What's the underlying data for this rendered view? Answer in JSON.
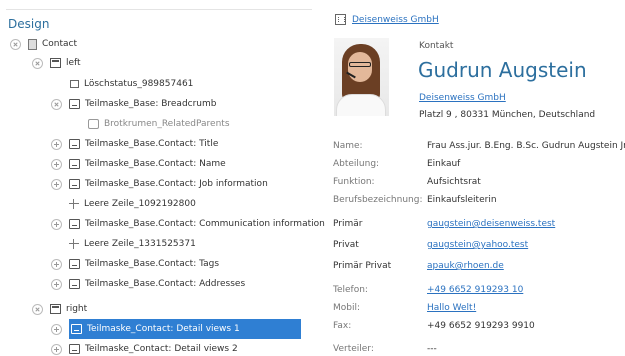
{
  "tree": {
    "title": "Design",
    "rows": [
      {
        "label": "Contact"
      },
      {
        "label": "left"
      },
      {
        "label": "Löschstatus_989857461"
      },
      {
        "label": "Teilmaske_Base: Breadcrumb"
      },
      {
        "label": "Brotkrumen_RelatedParents"
      },
      {
        "label": "Teilmaske_Base.Contact: Title"
      },
      {
        "label": "Teilmaske_Base.Contact: Name"
      },
      {
        "label": "Teilmaske_Base.Contact: Job information"
      },
      {
        "label": "Leere Zeile_1092192800"
      },
      {
        "label": "Teilmaske_Base.Contact: Communication information"
      },
      {
        "label": "Leere Zeile_1331525371"
      },
      {
        "label": "Teilmaske_Base.Contact: Tags"
      },
      {
        "label": "Teilmaske_Base.Contact: Addresses"
      },
      {
        "label": "right"
      },
      {
        "label": "Teilmaske_Contact: Detail views 1"
      },
      {
        "label": "Teilmaske_Contact: Detail views 2"
      }
    ]
  },
  "detail": {
    "company_header": "Deisenweiss GmbH",
    "type_label": "Kontakt",
    "person_name": "Gudrun Augstein",
    "company_link": "Deisenweiss GmbH",
    "address": "Platzl 9 , 80331 München, Deutschland",
    "fields": [
      {
        "label": "Name:",
        "value": "Frau Ass.jur. B.Eng. B.Sc. Gudrun Augstein Jr."
      },
      {
        "label": "Abteilung:",
        "value": "Einkauf"
      },
      {
        "label": "Funktion:",
        "value": "Aufsichtsrat"
      },
      {
        "label": "Berufsbezeichnung:",
        "value": "Einkaufsleiterin"
      },
      {
        "label": "Primär",
        "value": "gaugstein@deisenweiss.test"
      },
      {
        "label": "Privat",
        "value": "gaugstein@yahoo.test"
      },
      {
        "label": "Primär Privat",
        "value": "apauk@rhoen.de"
      },
      {
        "label": "Telefon:",
        "value": "+49 6652 919293 10"
      },
      {
        "label": "Mobil:",
        "value": "Hallo Welt!"
      },
      {
        "label": "Fax:",
        "value": "+49 6652 919293 9910"
      },
      {
        "label": "Verteiler:",
        "value": "---"
      }
    ]
  },
  "colors": {
    "accent": "#2d6f9e",
    "link": "#2b72c0",
    "selection": "#2f7fd3"
  }
}
